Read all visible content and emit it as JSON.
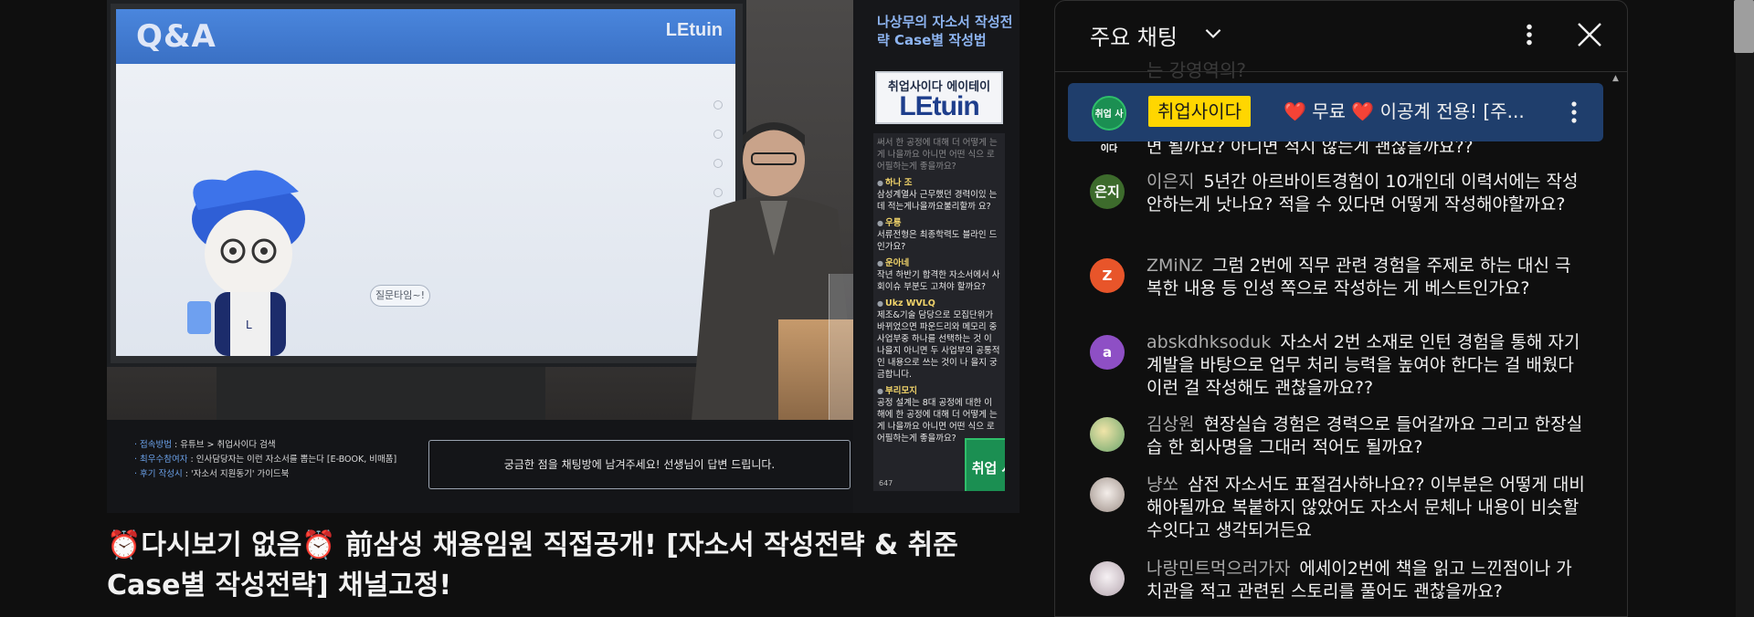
{
  "video": {
    "screen": {
      "qa_title": "Q&A",
      "logo": "LEtuin",
      "speech_bubble": "질문타임~!"
    },
    "panel": {
      "title": "나상무의 자소서 작성전략 Case별 작성법",
      "logo_top": "취업사이다 에이테이",
      "logo_main": "LEtuin",
      "mini_chat": [
        {
          "user": "",
          "text": "써서 한 공정에 대해 더 어떻게 는게 나을까요 아니면 어떤 식으 로 어필하는게 좋을까요?",
          "faded": true
        },
        {
          "user": "하나 조",
          "text": "삼성계열사 근무했던 경력이있 는데 적는게나을까요불리할까 요?"
        },
        {
          "user": "우룡",
          "text": "서류전형은 최종학력도 블라인 드인가요?"
        },
        {
          "user": "운아네",
          "text": "작년 하반기 합격한 자소서에서 사회이슈 부분도 고쳐야 할까요?"
        },
        {
          "user": "Ukz WVLQ",
          "text": "제조&기술 담당으로 모집단위가 바뀌었으면 파운드리와 메모리 중 사업부중 하나를 선택하는 것 이 나을지 아니면 두 사업부의 공통적인 내용으로 쓰는 것이 나 을지 궁금합니다."
        },
        {
          "user": "부리모지",
          "text": "공정 설계는 8대 공정에 대한 이 해에 한 공정에 대해 더 어떻게 는게 나을까요 아니면 어떤 식으 로 어필하는게 좋을까요?"
        }
      ],
      "badge": "취업 사이다",
      "count": "647"
    },
    "info": {
      "lines": [
        {
          "label": "· 접속방법",
          "value": " : 유튜브 > 취업사이다 검색"
        },
        {
          "label": "· 최우수참여자",
          "value": " : 인사담당자는 이런 자소서를 뽑는다 [E-BOOK, 비매품]"
        },
        {
          "label": "· 후기 작성시",
          "value": " : '자소서 지원동기' 가이드북"
        }
      ],
      "notice": "궁금한 점을 채팅방에 남겨주세요! 선생님이 답변 드립니다."
    }
  },
  "title": "⏰다시보기 없음⏰ 前삼성 채용임원 직접공개! [자소서 작성전략 & 취준 Case별 작성전략] 채널고정!",
  "chat": {
    "header_title": "주요 채팅",
    "icons": {
      "chevron": "chevron-down-icon",
      "more": "more-vert-icon",
      "close": "close-icon"
    },
    "pinned": {
      "author": "취업사이다",
      "avatar_text": "취업 사이다",
      "text": "❤️ 무료 ❤️ 이공계 전용! [주..."
    },
    "faded_top": "는 강영역의?",
    "continued_text": "면 될까요? 아니면 적지 않는게 괜찮을까요??",
    "messages": [
      {
        "author": "이은지",
        "avatar": "은지",
        "avatar_color": "#3d6b2c",
        "text": "5년간 아르바이트경험이 10개인데 이력서에는 작성안하는게 낫나요? 적을 수 있다면 어떻게 작성해야할까요?"
      },
      {
        "author": "ZMiNZ",
        "avatar": "Z",
        "avatar_color": "#e8552a",
        "text": "그럼 2번에 직무 관련 경험을 주제로 하는 대신 극복한 내용 등 인성 쪽으로 작성하는 게 베스트인가요?"
      },
      {
        "author": "abskdhksoduk",
        "avatar": "a",
        "avatar_color": "#8e4fc5",
        "text": "자소서 2번 소재로 인턴 경험을 통해 자기계발을 바탕으로 업무 처리 능력을 높여야 한다는 걸 배웠다 이런 걸 작성해도 괜찮을까요??"
      },
      {
        "author": "김상원",
        "avatar": "",
        "avatar_color": "#c8b98a",
        "text": "현장실습 경험은 경력으로 들어갈까요 그리고 한장실습 한 회사명을 그대러 적어도 될까요?"
      },
      {
        "author": "냥쏘",
        "avatar": "",
        "avatar_color": "#d9cfc9",
        "text": "삼전 자소서도 표절검사하나요?? 이부분은 어떻게 대비해야될까요 복붙하지 않았어도 자소서 문체나 내용이 비슷할수잇다고 생각되거든요"
      },
      {
        "author": "나랑민트먹으러가자",
        "avatar": "",
        "avatar_color": "#e8e0e6",
        "text": "에세이2번에 책을 읽고 느낀점이나 가치관을 적고 관련된 스토리를 풀어도 괜찮을까요?"
      }
    ]
  }
}
